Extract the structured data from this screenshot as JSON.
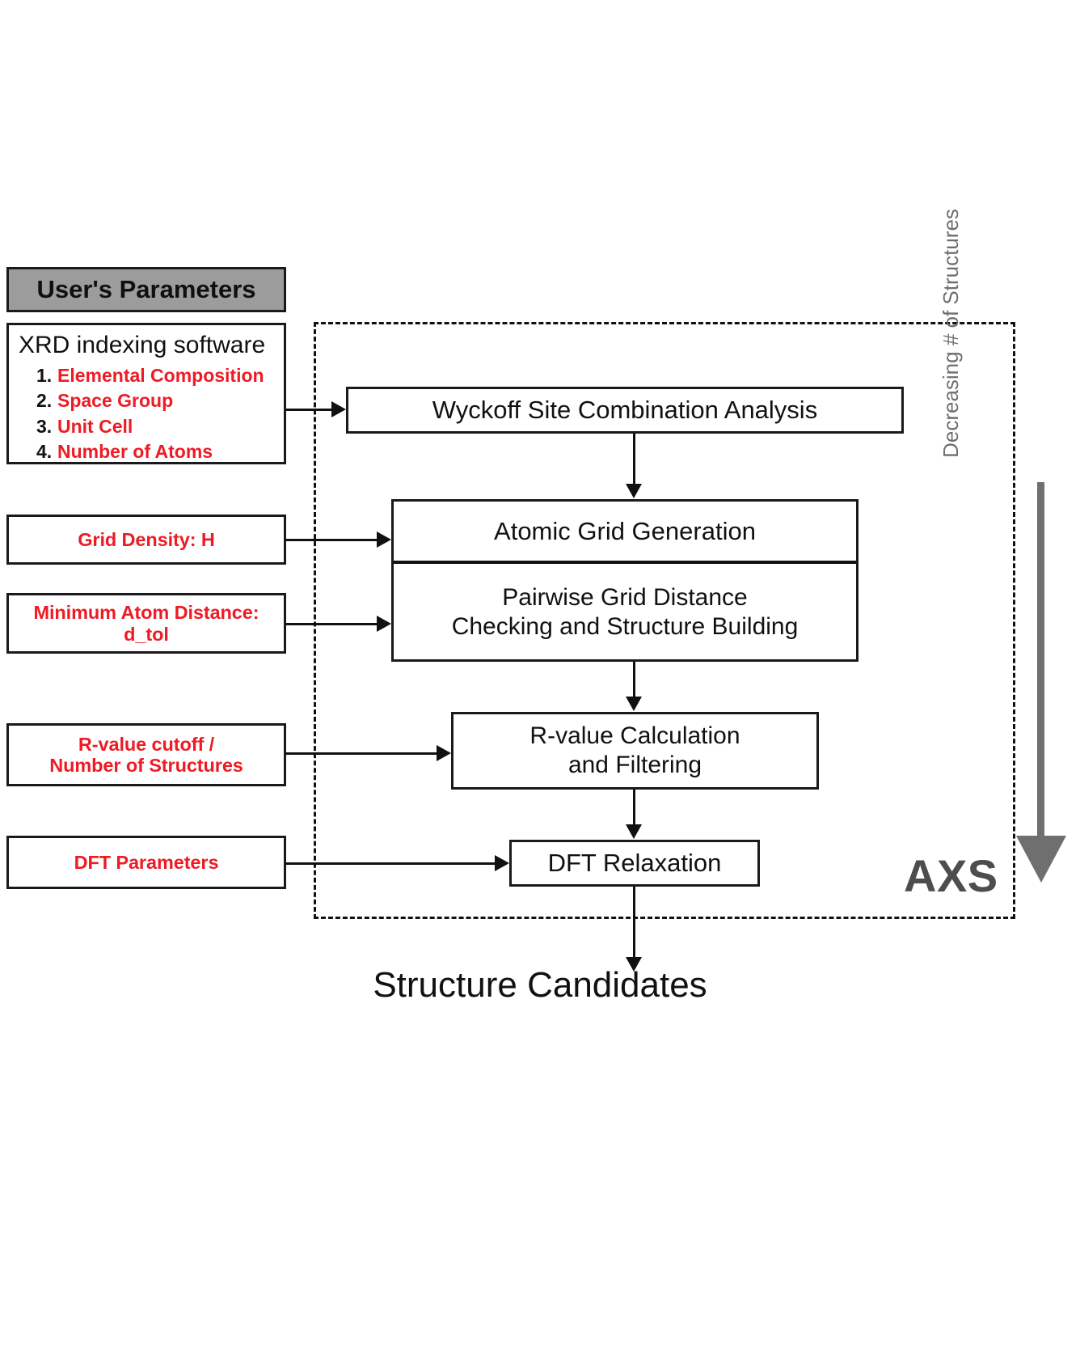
{
  "header": {
    "users_parameters": "User's Parameters"
  },
  "left_params": {
    "xrd": {
      "title": "XRD indexing software",
      "items": [
        {
          "num": "1.",
          "label": "Elemental Composition"
        },
        {
          "num": "2.",
          "label": "Space Group"
        },
        {
          "num": "3.",
          "label": "Unit Cell"
        },
        {
          "num": "4.",
          "label": "Number of Atoms"
        }
      ]
    },
    "grid_density": "Grid Density: H",
    "min_atom_distance_line1": "Minimum Atom Distance:",
    "min_atom_distance_line2": "d_tol",
    "rvalue_cutoff_line1": "R-value cutoff /",
    "rvalue_cutoff_line2": "Number of Structures",
    "dft_parameters": "DFT Parameters"
  },
  "pipeline": {
    "wyckoff": "Wyckoff Site Combination Analysis",
    "atomic_grid_generation": "Atomic Grid Generation",
    "pairwise_line1": "Pairwise Grid Distance",
    "pairwise_line2": "Checking and Structure Building",
    "rvalue_calc_line1": "R-value Calculation",
    "rvalue_calc_line2": "and Filtering",
    "dft_relaxation": "DFT Relaxation"
  },
  "output": {
    "structure_candidates": "Structure Candidates"
  },
  "annotations": {
    "decreasing": "Decreasing # of Structures",
    "axs": "AXS"
  },
  "colors": {
    "red": "#ee1b24",
    "gray_header": "#9c9c9c",
    "gray_arrow": "#6f6f6f",
    "axs_label": "#4d4d4d",
    "black": "#111111"
  }
}
